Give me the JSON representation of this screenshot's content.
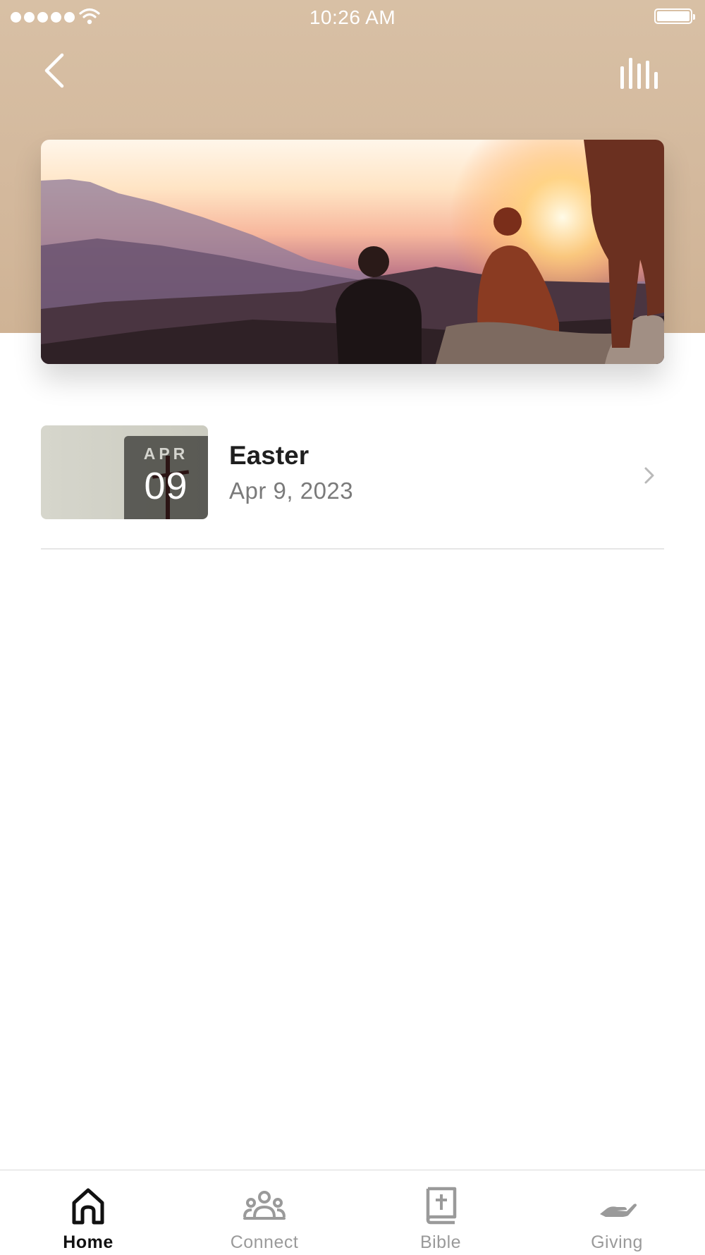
{
  "status_bar": {
    "time": "10:26 AM",
    "signal_icon": "signal-dots-icon",
    "wifi_icon": "wifi-icon",
    "battery_icon": "battery-icon"
  },
  "header": {
    "back_icon": "chevron-left-icon",
    "audio_icon": "audio-bars-icon",
    "background_color": "#d6bca0"
  },
  "hero": {
    "image": "sunset-mountain-people-photo"
  },
  "list": {
    "items": [
      {
        "badge_month": "APR",
        "badge_day": "09",
        "title": "Easter",
        "date": "Apr 9, 2023",
        "chevron_icon": "chevron-right-icon"
      }
    ]
  },
  "tab_bar": {
    "tabs": [
      {
        "label": "Home",
        "icon": "home-icon",
        "active": true
      },
      {
        "label": "Connect",
        "icon": "people-group-icon",
        "active": false
      },
      {
        "label": "Bible",
        "icon": "bible-icon",
        "active": false
      },
      {
        "label": "Giving",
        "icon": "giving-hand-icon",
        "active": false
      }
    ]
  }
}
